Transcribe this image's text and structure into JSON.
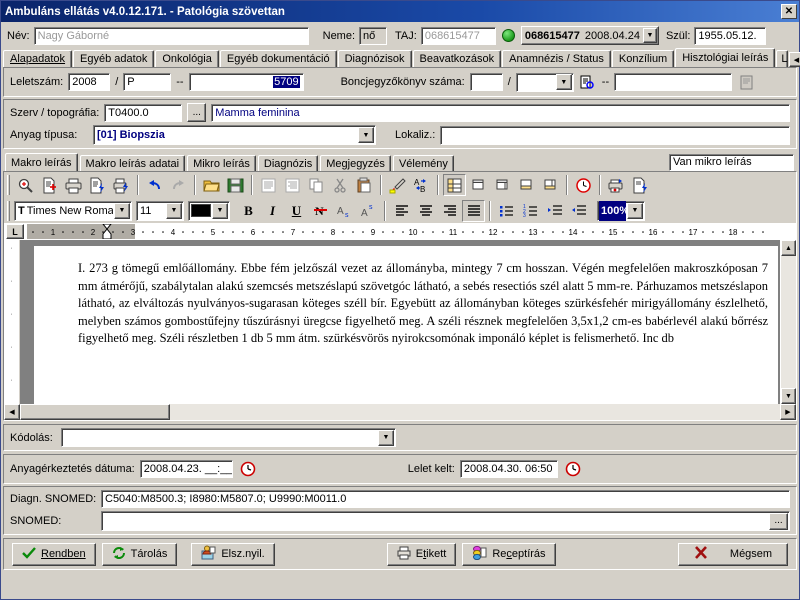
{
  "window": {
    "title": "Ambuláns ellátás v4.0.12.171. - Patológia szövettan",
    "close_label": "✕"
  },
  "patient": {
    "name_label": "Név:",
    "name_value": "Nagy Gáborné",
    "gender_label": "Neme:",
    "gender_value": "nő",
    "taj_label": "TAJ:",
    "taj_value": "068615477",
    "status_icon": "green-status-icon",
    "case_id": "068615477",
    "case_date": "2008.04.24",
    "birth_label": "Szül:",
    "birth_value": "1955.05.12."
  },
  "tabs": {
    "items": [
      {
        "label": "Alapadatok",
        "active": false
      },
      {
        "label": "Egyéb adatok",
        "active": false
      },
      {
        "label": "Onkológia",
        "active": false
      },
      {
        "label": "Egyéb dokumentáció",
        "active": false
      },
      {
        "label": "Diagnózisok",
        "active": false
      },
      {
        "label": "Beavatkozások",
        "active": false
      },
      {
        "label": "Anamnézis / Status",
        "active": false
      },
      {
        "label": "Konzílium",
        "active": false
      },
      {
        "label": "Hisztológiai leírás",
        "active": true
      },
      {
        "label": "Le",
        "active": false
      }
    ],
    "scroll_left": "◀",
    "scroll_right": "▶"
  },
  "record_row": {
    "leletszam_label": "Leletszám:",
    "year_value": "2008",
    "slash": "/",
    "prefix_value": "P",
    "dashes": "--",
    "number_value": "5709",
    "boncjegyzokonyv_label": "Boncjegyzőkönyv száma:",
    "bonc_num_value": "",
    "bonc_combo_value": "",
    "bonc_dash": "--",
    "bonc_tail_value": ""
  },
  "organ_row": {
    "label": "Szerv / topográfia:",
    "code_value": "T0400.0",
    "browse_label": "...",
    "desc_value": "Mamma feminina"
  },
  "material_row": {
    "label": "Anyag típusa:",
    "value": "[01] Biopszia",
    "lokaliz_label": "Lokaliz.:",
    "lokaliz_value": ""
  },
  "subtabs": {
    "items": [
      {
        "label": "Makro leírás",
        "active": true
      },
      {
        "label": "Makro leírás adatai",
        "active": false
      },
      {
        "label": "Mikro leírás",
        "active": false
      },
      {
        "label": "Diagnózis",
        "active": false
      },
      {
        "label": "Megjegyzés",
        "active": false
      },
      {
        "label": "Vélemény",
        "active": false
      }
    ],
    "micro_note": "Van mikro leírás"
  },
  "toolbar": {
    "buttons": [
      {
        "name": "zoom-preview-icon",
        "glyph": "🔍"
      },
      {
        "name": "new-document-icon",
        "glyph": "📄"
      },
      {
        "name": "print-icon",
        "glyph": "🖨"
      },
      {
        "name": "document-import-icon",
        "glyph": "📄"
      },
      {
        "name": "printer-import-icon",
        "glyph": "🖨"
      },
      {
        "name": "undo-icon",
        "glyph": "↰"
      },
      {
        "name": "redo-icon",
        "glyph": "↱"
      },
      {
        "name": "open-folder-icon",
        "glyph": "📂"
      },
      {
        "name": "save-icon",
        "glyph": "💾"
      },
      {
        "name": "text-block-icon",
        "glyph": "▤"
      },
      {
        "name": "text-block-alt-icon",
        "glyph": "▥"
      },
      {
        "name": "copy-icon",
        "glyph": "⎘"
      },
      {
        "name": "cut-icon",
        "glyph": "✂"
      },
      {
        "name": "paste-icon",
        "glyph": "📋"
      },
      {
        "name": "format-painter-icon",
        "glyph": "🖌"
      },
      {
        "name": "spellcheck-icon",
        "glyph": "A✓"
      },
      {
        "name": "insert-table-icon",
        "glyph": "▦"
      },
      {
        "name": "window-1-icon",
        "glyph": "❐"
      },
      {
        "name": "window-2-icon",
        "glyph": "❐"
      },
      {
        "name": "window-3-icon",
        "glyph": "❏"
      },
      {
        "name": "window-4-icon",
        "glyph": "❏"
      },
      {
        "name": "clock-icon",
        "glyph": "🕐"
      },
      {
        "name": "print-red-icon",
        "glyph": "🖨"
      },
      {
        "name": "document-blue-icon",
        "glyph": "📄"
      }
    ]
  },
  "format_bar": {
    "font_name": "Times New Roma",
    "font_size": "11",
    "color_swatch": "#000000",
    "bold_label": "B",
    "italic_label": "I",
    "underline_label": "U",
    "strikethrough_label": "S",
    "subscript_label": "A",
    "superscript_label": "A",
    "align_left_icon": "align-left-icon",
    "align_center_icon": "align-center-icon",
    "align_right_icon": "align-right-icon",
    "align_justify_icon": "align-justify-icon",
    "bullet_list_icon": "bullet-list-icon",
    "numbered_list_icon": "numbered-list-icon",
    "indent_increase_icon": "indent-increase-icon",
    "indent_decrease_icon": "indent-decrease-icon",
    "zoom_value": "100%"
  },
  "ruler": {
    "corner_label": "L",
    "ticks": [
      "1",
      "2",
      "3",
      "4",
      "5",
      "6",
      "7",
      "8",
      "9",
      "10",
      "11",
      "12",
      "13",
      "14",
      "15",
      "16",
      "17",
      "18"
    ]
  },
  "document": {
    "body": "I. 273 g tömegű emlőállomány. Ebbe fém jelzőszál vezet az állományba, mintegy 7 cm hosszan. Végén megfelelően makroszkóposan 7 mm átmérőjű, szabálytalan alakú szemcsés metszéslapú szövetgóc látható, a sebés resectiós szél alatt  5 mm-re. Párhuzamos metszéslapon látható, az elváltozás nyulványos-sugarasan köteges széll bír. Egyebütt az állományban köteges szürkésfehér mirigyállomány észlelhető, melyben számos gombostűfejny tűszúrásnyi üregcse figyelhető meg. A széli résznek megfelelően 3,5x1,2 cm-es babérlevél alakú bőrrész figyelhető meg. Széli részletben 1 db 5 mm átm. szürkésvörös nyirokcsomónak imponáló képlet is felismerhető. Inc db"
  },
  "coding": {
    "label": "Kódolás:",
    "value": ""
  },
  "dates": {
    "arrival_label": "Anyagérkeztetés dátuma:",
    "arrival_value": "2008.04.23.  __:__",
    "arrival_icon": "clock-icon",
    "result_label": "Lelet kelt:",
    "result_value": "2008.04.30.  06:50",
    "result_icon": "clock-icon"
  },
  "snomed": {
    "diag_label": "Diagn. SNOMED:",
    "diag_value": "C5040:M8500.3; I8980:M5807.0; U9990:M0011.0",
    "snomed_label": "SNOMED:",
    "snomed_value": "",
    "browse_label": "..."
  },
  "footer": {
    "ok_label": "Rendben",
    "ok_accel": "R",
    "store_label": "Tárolás",
    "settlement_label": "Elsz.nyil.",
    "label_label": "Etikett",
    "label_accel": "t",
    "prescription_label": "Receptírás",
    "prescription_accel": "c",
    "cancel_label": "Mégsem"
  },
  "colors": {
    "titlebar_start": "#0a246a",
    "titlebar_end": "#4a7fd4",
    "face": "#d4d0c8",
    "field_text_blue": "#000080",
    "selection_blue": "#000080",
    "status_green": "#22aa22"
  }
}
